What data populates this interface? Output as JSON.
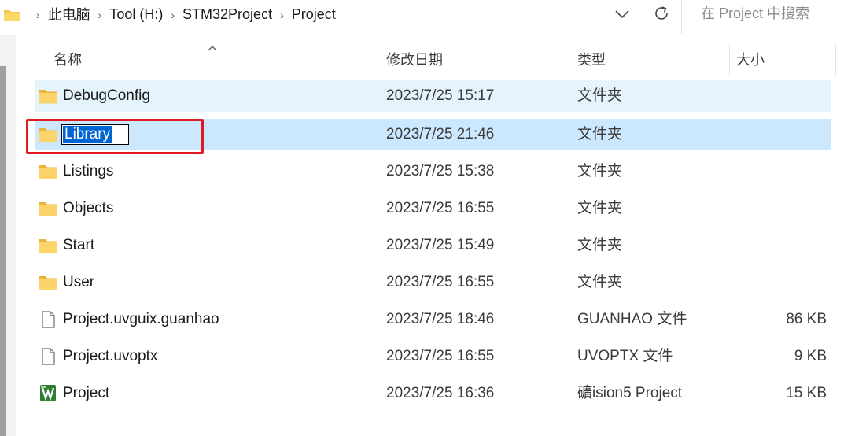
{
  "address_bar": {
    "crumbs": [
      "此电脑",
      "Tool (H:)",
      "STM32Project",
      "Project"
    ],
    "crumb_separator": "›"
  },
  "search": {
    "placeholder": "在 Project 中搜索"
  },
  "columns": {
    "name": "名称",
    "date": "修改日期",
    "type": "类型",
    "size": "大小"
  },
  "files": [
    {
      "name": "DebugConfig",
      "date": "2023/7/25 15:17",
      "type": "文件夹",
      "size": "",
      "icon": "folder-icon",
      "state": "hover"
    },
    {
      "name": "Library",
      "date": "2023/7/25 21:46",
      "type": "文件夹",
      "size": "",
      "icon": "folder-icon",
      "state": "selected-renaming"
    },
    {
      "name": "Listings",
      "date": "2023/7/25 15:38",
      "type": "文件夹",
      "size": "",
      "icon": "folder-icon",
      "state": ""
    },
    {
      "name": "Objects",
      "date": "2023/7/25 16:55",
      "type": "文件夹",
      "size": "",
      "icon": "folder-icon",
      "state": ""
    },
    {
      "name": "Start",
      "date": "2023/7/25 15:49",
      "type": "文件夹",
      "size": "",
      "icon": "folder-icon",
      "state": ""
    },
    {
      "name": "User",
      "date": "2023/7/25 16:55",
      "type": "文件夹",
      "size": "",
      "icon": "folder-icon",
      "state": ""
    },
    {
      "name": "Project.uvguix.guanhao",
      "date": "2023/7/25 18:46",
      "type": "GUANHAO 文件",
      "size": "86 KB",
      "icon": "file-icon",
      "state": ""
    },
    {
      "name": "Project.uvoptx",
      "date": "2023/7/25 16:55",
      "type": "UVOPTX 文件",
      "size": "9 KB",
      "icon": "file-icon",
      "state": ""
    },
    {
      "name": "Project",
      "date": "2023/7/25 16:36",
      "type": "礦ision5 Project",
      "size": "15 KB",
      "icon": "keil-project-icon",
      "state": ""
    }
  ],
  "colors": {
    "hover_row": "#e5f3fd",
    "selected_row": "#cce8ff",
    "rename_highlight": "#0064d2",
    "annotation_red": "#e01a22",
    "folder_yellow": "#f8d775"
  }
}
